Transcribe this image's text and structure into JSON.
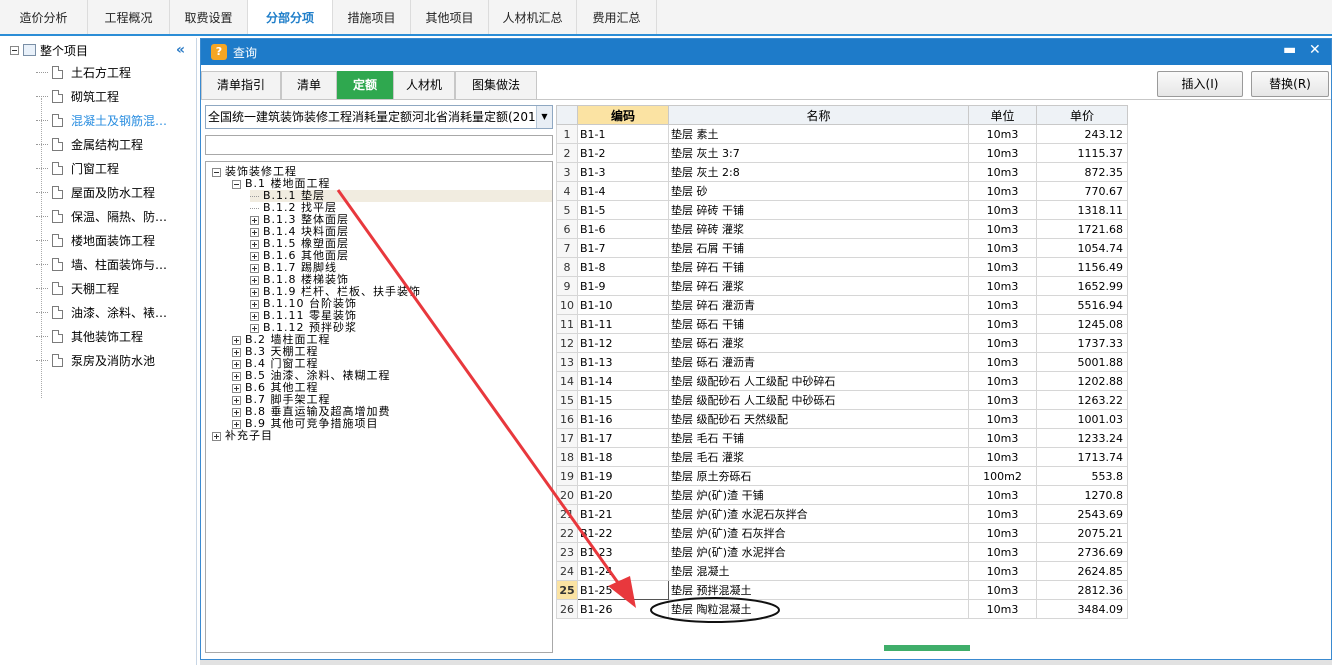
{
  "top_tabs": [
    {
      "label": "造价分析"
    },
    {
      "label": "工程概况"
    },
    {
      "label": "取费设置"
    },
    {
      "label": "分部分项"
    },
    {
      "label": "措施项目"
    },
    {
      "label": "其他项目"
    },
    {
      "label": "人材机汇总"
    },
    {
      "label": "费用汇总"
    }
  ],
  "left_tree": {
    "root": "整个项目",
    "items": [
      {
        "label": "土石方工程"
      },
      {
        "label": "砌筑工程"
      },
      {
        "label": "混凝土及钢筋混…"
      },
      {
        "label": "金属结构工程"
      },
      {
        "label": "门窗工程"
      },
      {
        "label": "屋面及防水工程"
      },
      {
        "label": "保温、隔热、防…"
      },
      {
        "label": "楼地面装饰工程"
      },
      {
        "label": "墙、柱面装饰与…"
      },
      {
        "label": "天棚工程"
      },
      {
        "label": "油漆、涂料、裱…"
      },
      {
        "label": "其他装饰工程"
      },
      {
        "label": "泵房及消防水池"
      }
    ]
  },
  "dialog": {
    "title": "查询",
    "tabs": [
      {
        "label": "清单指引"
      },
      {
        "label": "清单"
      },
      {
        "label": "定额"
      },
      {
        "label": "人材机"
      },
      {
        "label": "图集做法"
      }
    ],
    "insert_button": "插入(I)",
    "replace_button": "替换(R)",
    "library": "全国统一建筑装饰装修工程消耗量定额河北省消耗量定额(2012)",
    "search_value": ""
  },
  "quota_tree": [
    {
      "label": "装饰装修工程",
      "expander": "minus"
    },
    {
      "label": "B.1 楼地面工程",
      "expander": "minus"
    },
    {
      "label": "B.1.1 垫层",
      "expander": "none"
    },
    {
      "label": "B.1.2 找平层",
      "expander": "none"
    },
    {
      "label": "B.1.3 整体面层",
      "expander": "plus"
    },
    {
      "label": "B.1.4 块料面层",
      "expander": "plus"
    },
    {
      "label": "B.1.5 橡塑面层",
      "expander": "plus"
    },
    {
      "label": "B.1.6 其他面层",
      "expander": "plus"
    },
    {
      "label": "B.1.7 踢脚线",
      "expander": "plus"
    },
    {
      "label": "B.1.8 楼梯装饰",
      "expander": "plus"
    },
    {
      "label": "B.1.9 栏杆、栏板、扶手装饰",
      "expander": "plus"
    },
    {
      "label": "B.1.10 台阶装饰",
      "expander": "plus"
    },
    {
      "label": "B.1.11 零星装饰",
      "expander": "plus"
    },
    {
      "label": "B.1.12 预拌砂浆",
      "expander": "plus"
    },
    {
      "label": "B.2 墙柱面工程",
      "expander": "plus"
    },
    {
      "label": "B.3 天棚工程",
      "expander": "plus"
    },
    {
      "label": "B.4 门窗工程",
      "expander": "plus"
    },
    {
      "label": "B.5 油漆、涂料、裱糊工程",
      "expander": "plus"
    },
    {
      "label": "B.6 其他工程",
      "expander": "plus"
    },
    {
      "label": "B.7 脚手架工程",
      "expander": "plus"
    },
    {
      "label": "B.8 垂直运输及超高增加费",
      "expander": "plus"
    },
    {
      "label": "B.9 其他可竞争措施项目",
      "expander": "plus"
    },
    {
      "label": "补充子目",
      "expander": "plus"
    }
  ],
  "grid": {
    "headers": {
      "code": "编码",
      "name": "名称",
      "unit": "单位",
      "price": "单价"
    },
    "rows": [
      {
        "n": "1",
        "code": "B1-1",
        "name": "垫层 素土",
        "unit": "10m3",
        "price": "243.12"
      },
      {
        "n": "2",
        "code": "B1-2",
        "name": "垫层 灰土 3:7",
        "unit": "10m3",
        "price": "1115.37"
      },
      {
        "n": "3",
        "code": "B1-3",
        "name": "垫层 灰土 2:8",
        "unit": "10m3",
        "price": "872.35"
      },
      {
        "n": "4",
        "code": "B1-4",
        "name": "垫层 砂",
        "unit": "10m3",
        "price": "770.67"
      },
      {
        "n": "5",
        "code": "B1-5",
        "name": "垫层 碎砖 干铺",
        "unit": "10m3",
        "price": "1318.11"
      },
      {
        "n": "6",
        "code": "B1-6",
        "name": "垫层 碎砖 灌浆",
        "unit": "10m3",
        "price": "1721.68"
      },
      {
        "n": "7",
        "code": "B1-7",
        "name": "垫层 石屑 干铺",
        "unit": "10m3",
        "price": "1054.74"
      },
      {
        "n": "8",
        "code": "B1-8",
        "name": "垫层 碎石 干铺",
        "unit": "10m3",
        "price": "1156.49"
      },
      {
        "n": "9",
        "code": "B1-9",
        "name": "垫层 碎石 灌浆",
        "unit": "10m3",
        "price": "1652.99"
      },
      {
        "n": "10",
        "code": "B1-10",
        "name": "垫层 碎石 灌沥青",
        "unit": "10m3",
        "price": "5516.94"
      },
      {
        "n": "11",
        "code": "B1-11",
        "name": "垫层 砾石 干铺",
        "unit": "10m3",
        "price": "1245.08"
      },
      {
        "n": "12",
        "code": "B1-12",
        "name": "垫层 砾石 灌浆",
        "unit": "10m3",
        "price": "1737.33"
      },
      {
        "n": "13",
        "code": "B1-13",
        "name": "垫层 砾石 灌沥青",
        "unit": "10m3",
        "price": "5001.88"
      },
      {
        "n": "14",
        "code": "B1-14",
        "name": "垫层 级配砂石 人工级配 中砂碎石",
        "unit": "10m3",
        "price": "1202.88"
      },
      {
        "n": "15",
        "code": "B1-15",
        "name": "垫层 级配砂石 人工级配 中砂砾石",
        "unit": "10m3",
        "price": "1263.22"
      },
      {
        "n": "16",
        "code": "B1-16",
        "name": "垫层 级配砂石 天然级配",
        "unit": "10m3",
        "price": "1001.03"
      },
      {
        "n": "17",
        "code": "B1-17",
        "name": "垫层 毛石 干铺",
        "unit": "10m3",
        "price": "1233.24"
      },
      {
        "n": "18",
        "code": "B1-18",
        "name": "垫层 毛石 灌浆",
        "unit": "10m3",
        "price": "1713.74"
      },
      {
        "n": "19",
        "code": "B1-19",
        "name": "垫层 原土夯砾石",
        "unit": "100m2",
        "price": "553.8"
      },
      {
        "n": "20",
        "code": "B1-20",
        "name": "垫层 炉(矿)渣 干铺",
        "unit": "10m3",
        "price": "1270.8"
      },
      {
        "n": "21",
        "code": "B1-21",
        "name": "垫层 炉(矿)渣 水泥石灰拌合",
        "unit": "10m3",
        "price": "2543.69"
      },
      {
        "n": "22",
        "code": "B1-22",
        "name": "垫层 炉(矿)渣 石灰拌合",
        "unit": "10m3",
        "price": "2075.21"
      },
      {
        "n": "23",
        "code": "B1-23",
        "name": "垫层 炉(矿)渣 水泥拌合",
        "unit": "10m3",
        "price": "2736.69"
      },
      {
        "n": "24",
        "code": "B1-24",
        "name": "垫层 混凝土",
        "unit": "10m3",
        "price": "2624.85"
      },
      {
        "n": "25",
        "code": "B1-25",
        "name": "垫层 预拌混凝土",
        "unit": "10m3",
        "price": "2812.36"
      },
      {
        "n": "26",
        "code": "B1-26",
        "name": "垫层 陶粒混凝土",
        "unit": "10m3",
        "price": "3484.09"
      }
    ]
  },
  "colors": {
    "accent": "#1e7bc9",
    "active_tab": "#2fa84f",
    "annotation": "#e8383d",
    "selection": "#fbe3a3"
  }
}
